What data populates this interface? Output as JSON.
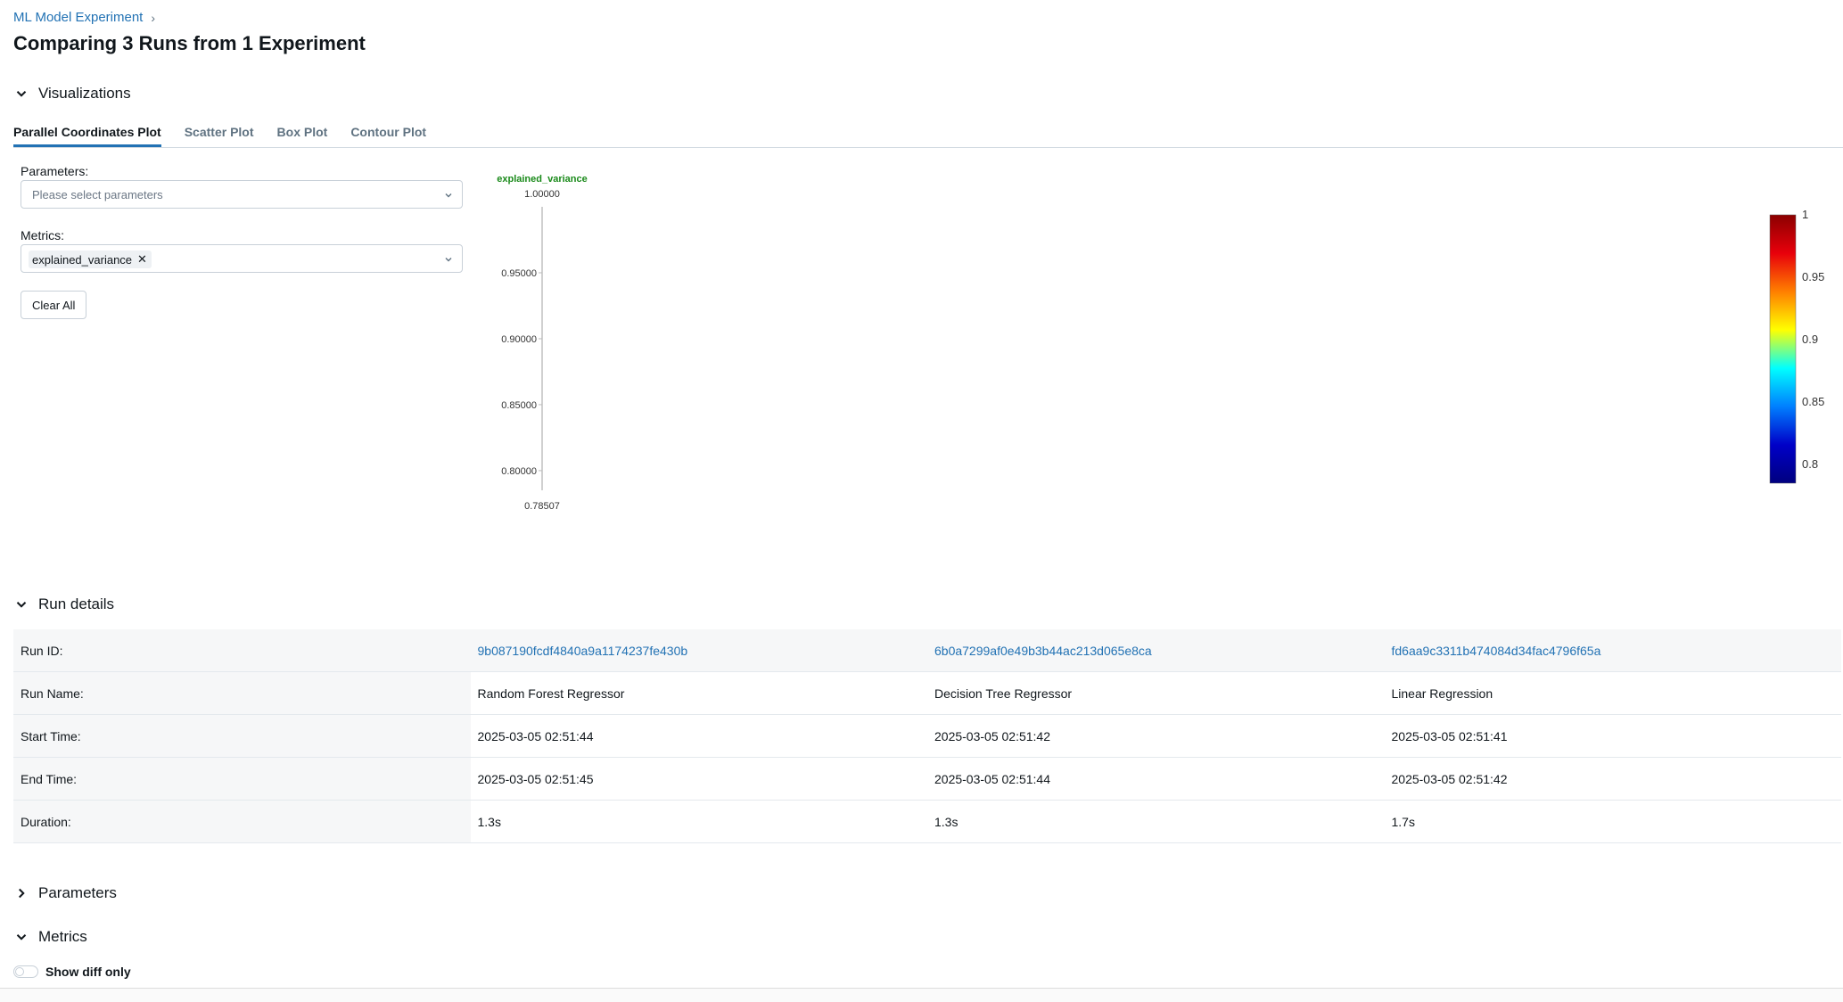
{
  "breadcrumb": {
    "experiment": "ML Model Experiment",
    "separator": "›"
  },
  "page_title": "Comparing 3 Runs from 1 Experiment",
  "sections": {
    "visualizations": "Visualizations",
    "run_details": "Run details",
    "parameters": "Parameters",
    "metrics": "Metrics"
  },
  "tabs": [
    {
      "label": "Parallel Coordinates Plot",
      "active": true
    },
    {
      "label": "Scatter Plot"
    },
    {
      "label": "Box Plot"
    },
    {
      "label": "Contour Plot"
    }
  ],
  "controls": {
    "parameters_label": "Parameters:",
    "parameters_placeholder": "Please select parameters",
    "metrics_label": "Metrics:",
    "metrics_tag": "explained_variance",
    "clear_all": "Clear All"
  },
  "chart_data": {
    "type": "parallel_coordinates",
    "axes": [
      {
        "name": "explained_variance",
        "max_label": "1.00000",
        "min_label": "0.78507",
        "range": [
          0.78507,
          1.0
        ],
        "ticks": [
          "0.95000",
          "0.90000",
          "0.85000",
          "0.80000"
        ]
      }
    ],
    "colorscale": {
      "range": [
        0.78507,
        1.0
      ],
      "ticks": [
        "1",
        "0.95",
        "0.9",
        "0.85",
        "0.8"
      ],
      "colors": [
        "#8b0000",
        "#e8000b",
        "#ff7f00",
        "#ffff00",
        "#00ffff",
        "#007fff",
        "#0000c8",
        "#00007f"
      ]
    }
  },
  "run_details": {
    "rows": [
      {
        "label": "Run ID:",
        "values": [
          "9b087190fcdf4840a9a1174237fe430b",
          "6b0a7299af0e49b3b44ac213d065e8ca",
          "fd6aa9c3311b474084d34fac4796f65a"
        ],
        "links": true
      },
      {
        "label": "Run Name:",
        "values": [
          "Random Forest Regressor",
          "Decision Tree Regressor",
          "Linear Regression"
        ]
      },
      {
        "label": "Start Time:",
        "values": [
          "2025-03-05 02:51:44",
          "2025-03-05 02:51:42",
          "2025-03-05 02:51:41"
        ]
      },
      {
        "label": "End Time:",
        "values": [
          "2025-03-05 02:51:45",
          "2025-03-05 02:51:44",
          "2025-03-05 02:51:42"
        ]
      },
      {
        "label": "Duration:",
        "values": [
          "1.3s",
          "1.3s",
          "1.7s"
        ]
      }
    ]
  },
  "show_diff_only": "Show diff only"
}
